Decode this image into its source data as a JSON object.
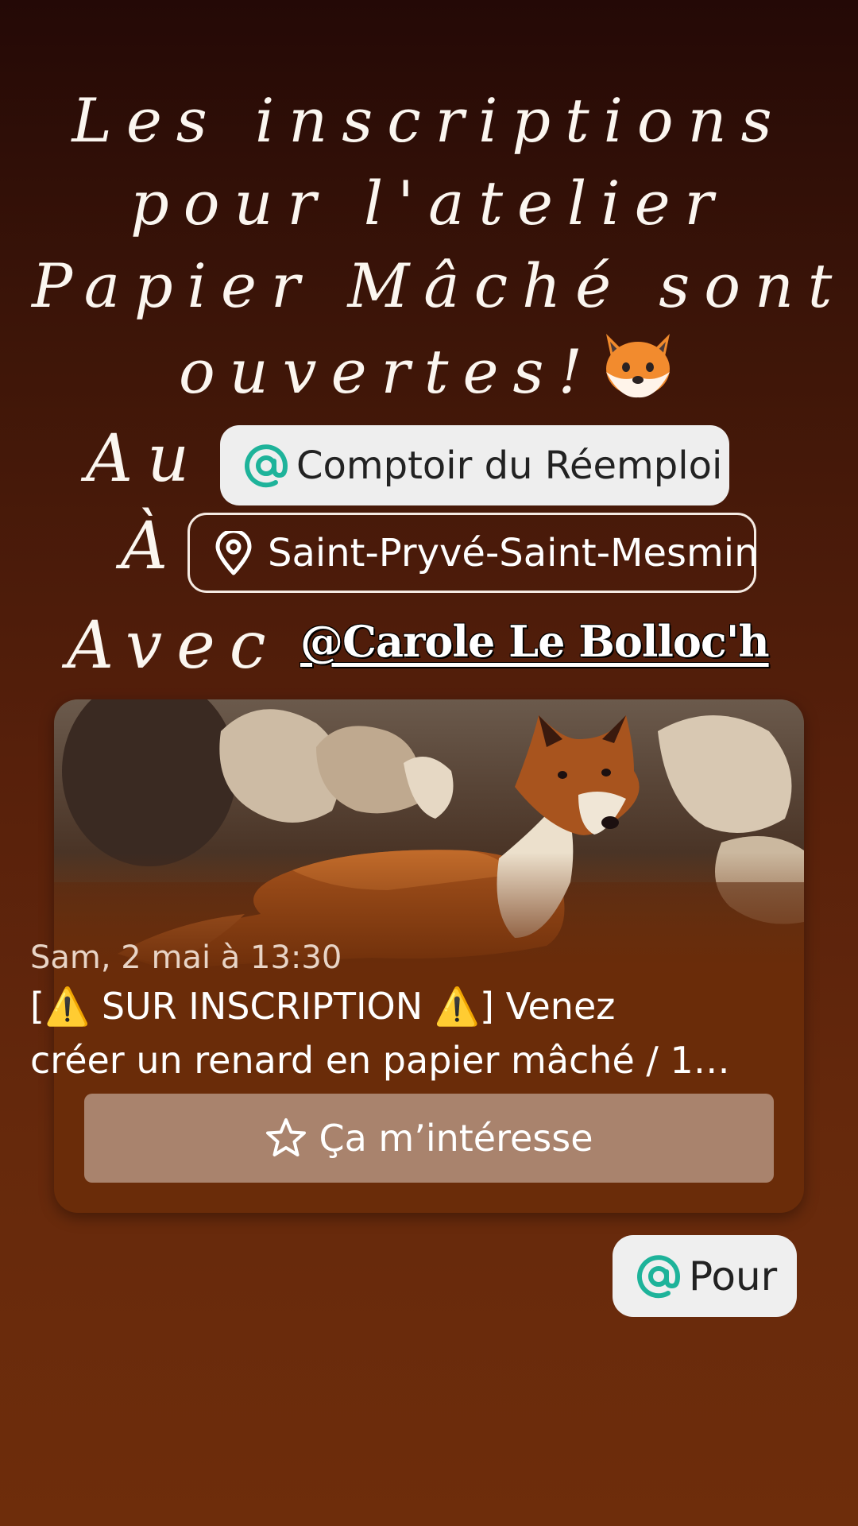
{
  "headline": {
    "line1": "Les inscriptions",
    "line2": "pour l'atelier",
    "line3": "Papier Mâché sont",
    "line4": "ouvertes!"
  },
  "labels": {
    "venue": "Au",
    "place": "À",
    "host": "Avec"
  },
  "venue_chip": {
    "text": "Comptoir du Réemploi"
  },
  "location_chip": {
    "text": "Saint-Pryvé-Saint-Mesmin"
  },
  "mention": {
    "text": "@Carole Le Bolloc'h"
  },
  "event_card": {
    "date": "Sam, 2 mai à 13:30",
    "title_line1": "[⚠️ SUR INSCRIPTION ⚠️] Venez",
    "title_line2": "créer un renard en papier mâché / 1…",
    "interest_label": "Ça m’intéresse"
  },
  "recipient_chip": {
    "text": "Pour"
  },
  "colors": {
    "at_icon": "#1eb39a",
    "card_background": "#6a2c09",
    "button_background": "#a9836d"
  },
  "icons": [
    "fox-emoji",
    "at-icon",
    "location-pin-icon",
    "star-icon"
  ]
}
